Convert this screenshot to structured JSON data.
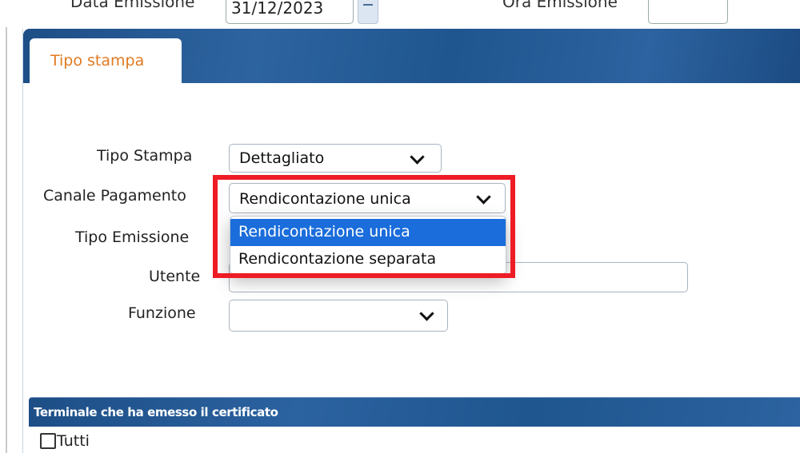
{
  "top_row": {
    "date_label": "Data Emissione",
    "date_value": "31/12/2023",
    "time_label": "Ora Emissione"
  },
  "tab": {
    "label": "Tipo stampa"
  },
  "form": {
    "tipo_stampa": {
      "label": "Tipo Stampa",
      "value": "Dettagliato"
    },
    "canale_pagamento": {
      "label": "Canale Pagamento",
      "value": "Rendicontazione unica",
      "options": [
        "Rendicontazione unica",
        "Rendicontazione separata"
      ],
      "selected_index": 0
    },
    "tipo_emissione": {
      "label": "Tipo Emissione"
    },
    "utente": {
      "label": "Utente",
      "value": ""
    },
    "funzione": {
      "label": "Funzione",
      "value": ""
    }
  },
  "section": {
    "title": "Terminale che ha emesso il certificato"
  },
  "checkbox": {
    "label": "Tutti",
    "checked": false
  },
  "colors": {
    "header_blue": "#1d4e86",
    "tab_text": "#e07a22",
    "selected_option": "#1a6ddb",
    "highlight_border": "#ee1c25"
  }
}
